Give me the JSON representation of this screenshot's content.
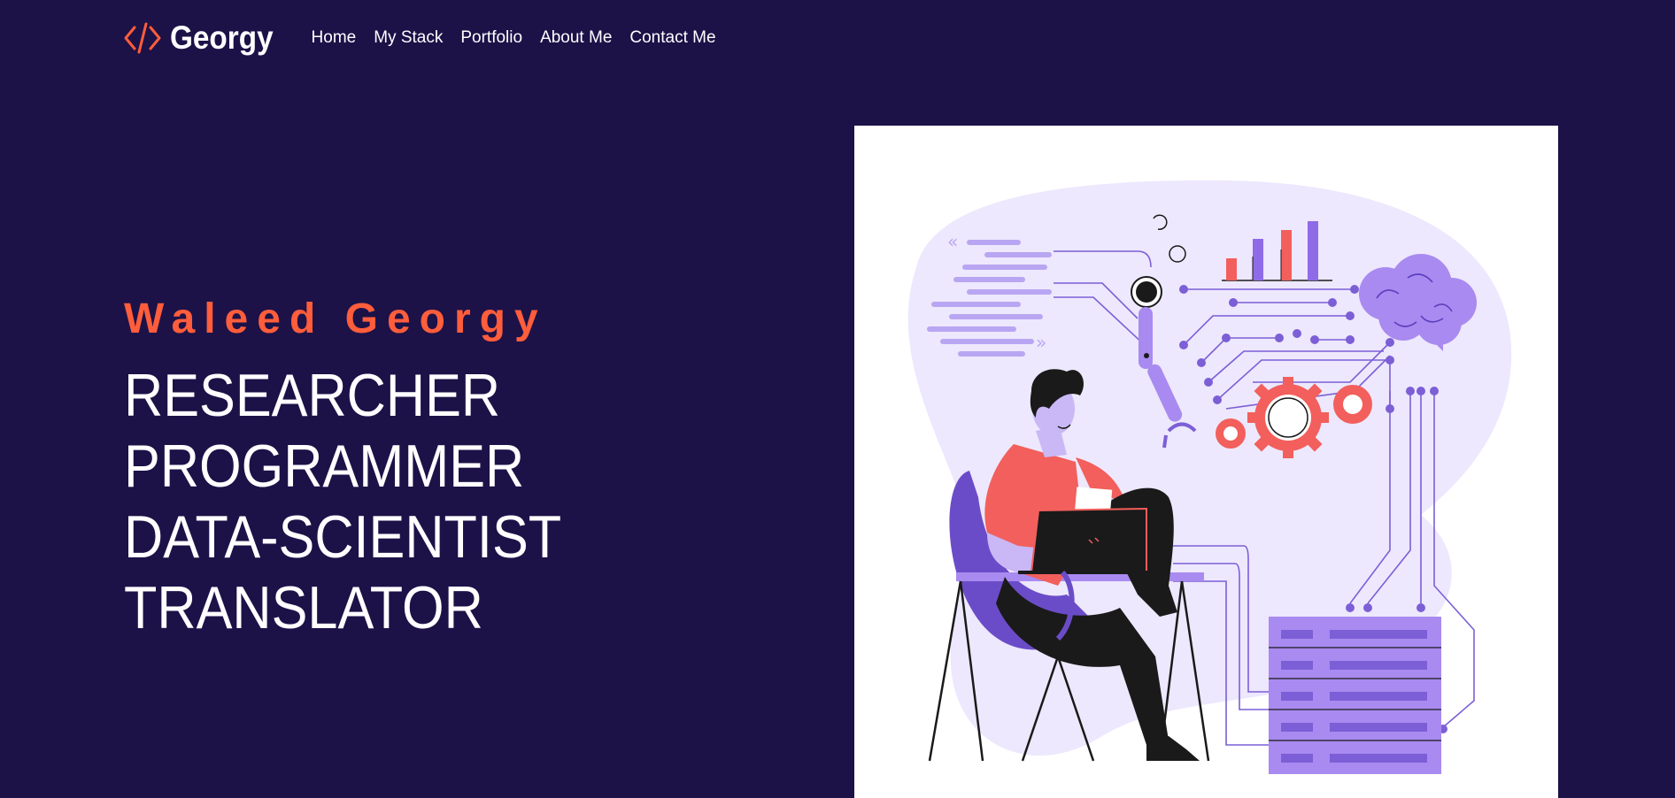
{
  "logo": {
    "text": "Georgy",
    "icon": "code-brackets-icon",
    "icon_color": "#ff5d3b"
  },
  "nav": {
    "items": [
      {
        "label": "Home"
      },
      {
        "label": "My Stack"
      },
      {
        "label": "Portfolio"
      },
      {
        "label": "About Me"
      },
      {
        "label": "Contact Me"
      }
    ]
  },
  "hero": {
    "name": "Waleed Georgy",
    "roles": [
      "RESEARCHER",
      "PROGRAMMER",
      "DATA-SCIENTIST",
      "TRANSLATOR"
    ]
  },
  "colors": {
    "background": "#1c1248",
    "accent": "#ff5d3b",
    "purple": "#8f6be8",
    "light_purple": "#ede8fd"
  }
}
